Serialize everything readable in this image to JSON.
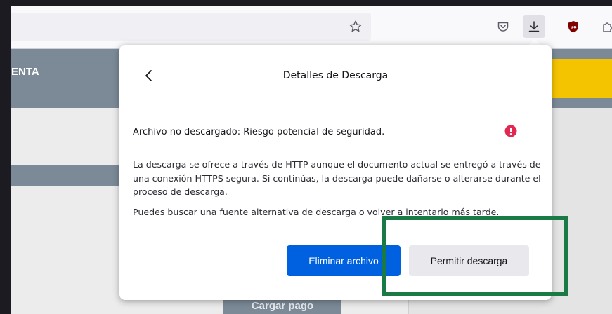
{
  "toolbar": {
    "icons": [
      "star-icon",
      "pocket-icon",
      "download-icon",
      "ublock-icon",
      "extensions-icon"
    ]
  },
  "page": {
    "header_text": "ENTA",
    "button_label": "Cargar pago"
  },
  "panel": {
    "title": "Detalles de Descarga",
    "headline": "Archivo no descargado: Riesgo potencial de seguridad.",
    "body1": "La descarga se ofrece a través de HTTP aunque el documento actual se entregó a través de una conexión HTTPS segura. Si continúas, la descarga puede dañarse o alterarse durante el proceso de descarga.",
    "body2": "Puedes buscar una fuente alternativa de descarga o volver a intentarlo más tarde.",
    "delete_label": "Eliminar archivo",
    "allow_label": "Permitir descarga"
  },
  "colors": {
    "primary_button": "#0061e0",
    "warning": "#e22850",
    "highlight": "#1a7a45",
    "page_header": "#7c8a98",
    "page_yellow": "#f5c400"
  }
}
